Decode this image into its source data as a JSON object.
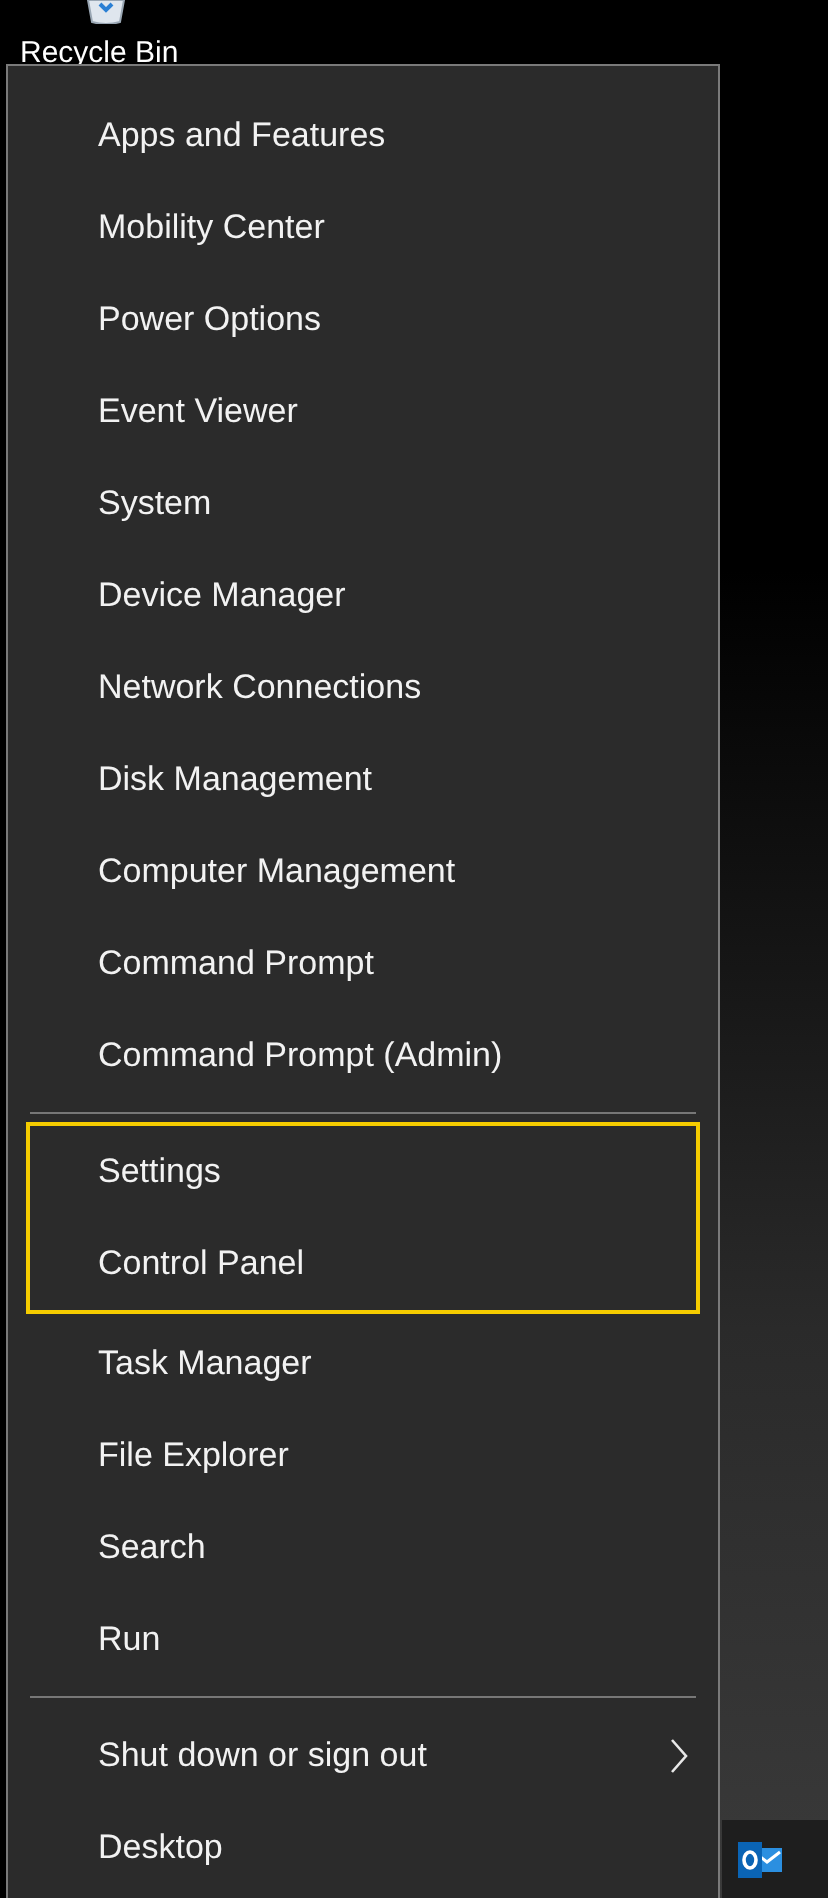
{
  "desktop": {
    "icon_label": "Recycle Bin"
  },
  "menu": {
    "sections": [
      {
        "blocks": [
          {
            "items": [
              {
                "label": "Apps and Features"
              },
              {
                "label": "Mobility Center"
              },
              {
                "label": "Power Options"
              },
              {
                "label": "Event Viewer"
              },
              {
                "label": "System"
              },
              {
                "label": "Device Manager"
              },
              {
                "label": "Network Connections"
              },
              {
                "label": "Disk Management"
              },
              {
                "label": "Computer Management"
              },
              {
                "label": "Command Prompt"
              },
              {
                "label": "Command Prompt (Admin)"
              }
            ]
          }
        ]
      },
      {
        "blocks": [
          {
            "highlighted": true,
            "items": [
              {
                "label": "Settings"
              },
              {
                "label": "Control Panel"
              }
            ]
          },
          {
            "items": [
              {
                "label": "Task Manager"
              },
              {
                "label": "File Explorer"
              },
              {
                "label": "Search"
              },
              {
                "label": "Run"
              }
            ]
          }
        ]
      },
      {
        "blocks": [
          {
            "items": [
              {
                "label": "Shut down or sign out",
                "submenu": true
              },
              {
                "label": "Desktop"
              }
            ]
          }
        ]
      }
    ]
  }
}
